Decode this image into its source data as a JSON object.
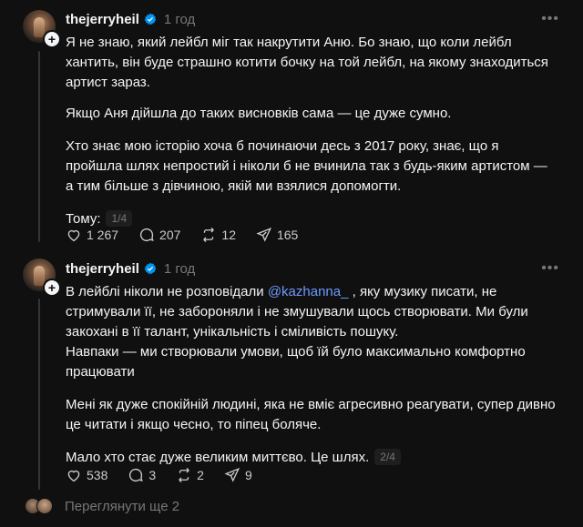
{
  "posts": [
    {
      "username": "thejerryheil",
      "time": "1 год",
      "paragraphs": [
        "Я не знаю, який лейбл міг так накрутити Аню. Бо знаю, що коли лейбл хантить, він буде страшно котити бочку на той лейбл, на якому знаходиться артист зараз.",
        "Якщо Аня дійшла до таких висновків сама — це дуже сумно.",
        "Хто знає мою історію хоча б починаючи десь з 2017 року, знає, що я пройшла шлях непростий і ніколи б не вчинила так з будь-яким артистом — а тим більше з дівчиною, якій ми взялися допомогти."
      ],
      "last_line": "Тому:",
      "counter": "1/4",
      "likes": "1 267",
      "comments": "207",
      "reposts": "12",
      "shares": "165"
    },
    {
      "username": "thejerryheil",
      "time": "1 год",
      "p1_before": "В лейблі ніколи не розповідали ",
      "mention": "@kazhanna_",
      "p1_after": " , яку музику писати, не стримували її, не забороняли і не змушували щось створювати. Ми були закохані в її талант, унікальність і сміливість пошуку.",
      "p1_line2": "Навпаки — ми створювали умови, щоб їй було максимально комфортно працювати",
      "p2": "Мені як дуже спокійній людині, яка не вміє агресивно реагувати, супер дивно це читати і якщо чесно, то піпец боляче.",
      "last_line": "Мало хто стає дуже великим миттєво. Це шлях.",
      "counter": "2/4",
      "likes": "538",
      "comments": "3",
      "reposts": "2",
      "shares": "9"
    }
  ],
  "more_replies": "Переглянути ще 2",
  "icons": [
    "verified-badge-icon",
    "more-icon",
    "heart-icon",
    "comment-icon",
    "repost-icon",
    "share-icon",
    "plus-icon"
  ],
  "accent": "#6e99ff"
}
